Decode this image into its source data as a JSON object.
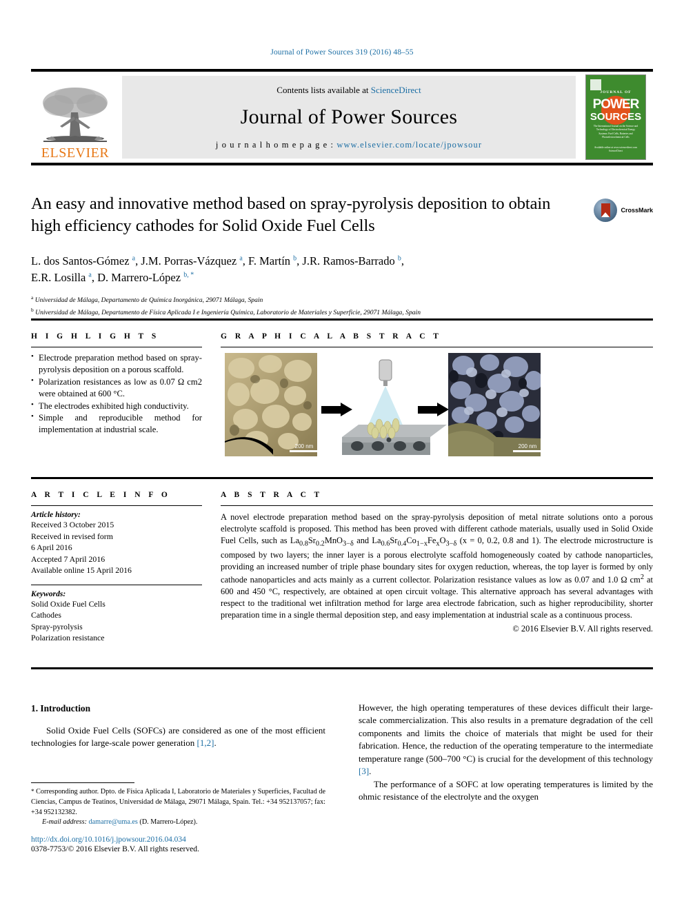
{
  "running_head": "Journal of Power Sources 319 (2016) 48–55",
  "masthead": {
    "publisher": "ELSEVIER",
    "contents_prefix": "Contents lists available at ",
    "contents_link": "ScienceDirect",
    "journal_title": "Journal of Power Sources",
    "homepage_prefix": "j o u r n a l   h o m e p a g e :  ",
    "homepage_url": "www.elsevier.com/locate/jpowsour",
    "cover": {
      "journal_of": "JOURNAL OF",
      "power": "POWER",
      "sources": "SOURCES",
      "blurb": "The International Journal on the Science and Technology of Electrochemical Energy Systems: Fuel Cells, Batteries and Photoelectrochemical Cells",
      "footer": "Available online at www.sciencedirect.com ScienceDirect"
    }
  },
  "article": {
    "title": "An easy and innovative method based on spray-pyrolysis deposition to obtain high efficiency cathodes for Solid Oxide Fuel Cells",
    "crossmark_label": "CrossMark",
    "authors_line1_parts": [
      {
        "name": "L. dos Santos-Gómez ",
        "sup": "a"
      },
      {
        "name": ", J.M. Porras-Vázquez ",
        "sup": "a"
      },
      {
        "name": ", F. Martín ",
        "sup": "b"
      },
      {
        "name": ", J.R. Ramos-Barrado ",
        "sup": "b"
      }
    ],
    "authors_line2_parts": [
      {
        "name": "E.R. Losilla ",
        "sup": "a"
      },
      {
        "name": ", D. Marrero-López ",
        "sup": "b, *"
      }
    ],
    "affiliations": [
      {
        "marker": "a",
        "text": "Universidad de Málaga, Departamento de Química Inorgánica, 29071 Málaga, Spain"
      },
      {
        "marker": "b",
        "text": "Universidad de Málaga, Departamento de Física Aplicada I e Ingeniería Química, Laboratorio de Materiales y Superficie, 29071 Málaga, Spain"
      }
    ]
  },
  "highlights": {
    "heading": "H I G H L I G H T S",
    "items": [
      "Electrode preparation method based on spray-pyrolysis deposition on a porous scaffold.",
      "Polarization resistances as low as 0.07 Ω cm2 were obtained at 600 °C.",
      "The electrodes exhibited high conductivity.",
      "Simple and reproducible method for implementation at industrial scale."
    ]
  },
  "graphical_abstract": {
    "heading": "G R A P H I C A L   A B S T R A C T",
    "scale_bar_left": "200 nm",
    "scale_bar_right": "200 nm"
  },
  "article_info": {
    "heading": "A R T I C L E   I N F O",
    "history_label": "Article history:",
    "history": [
      "Received 3 October 2015",
      "Received in revised form",
      "6 April 2016",
      "Accepted 7 April 2016",
      "Available online 15 April 2016"
    ],
    "keywords_label": "Keywords:",
    "keywords": [
      "Solid Oxide Fuel Cells",
      "Cathodes",
      "Spray-pyrolysis",
      "Polarization resistance"
    ]
  },
  "abstract": {
    "heading": "A B S T R A C T",
    "p1_a": "A novel electrode preparation method based on the spray-pyrolysis deposition of metal nitrate solutions onto a porous electrolyte scaffold is proposed. This method has been proved with different cathode materials, usually used in Solid Oxide Fuel Cells, such as ",
    "formula1": "La0.8Sr0.2MnO3−δ",
    "p1_b": " and ",
    "formula2": "La0.6Sr0.4Co1−xFexO3−δ",
    "p1_c": " (x = 0, 0.2, 0.8 and 1). The electrode microstructure is composed by two layers; the inner layer is a porous electrolyte scaffold homogeneously coated by cathode nanoparticles, providing an increased number of triple phase boundary sites for oxygen reduction, whereas, the top layer is formed by only cathode nanoparticles and acts mainly as a current collector. Polarization resistance values as low as 0.07 and 1.0 Ω cm2 at 600 and 450 °C, respectively, are obtained at open circuit voltage. This alternative approach has several advantages with respect to the traditional wet infiltration method for large area electrode fabrication, such as higher reproducibility, shorter preparation time in a single thermal deposition step, and easy implementation at industrial scale as a continuous process.",
    "copyright": "© 2016 Elsevier B.V. All rights reserved."
  },
  "body": {
    "section_number_title": "1.  Introduction",
    "left_p1_a": "Solid Oxide Fuel Cells (SOFCs) are considered as one of the most efficient technologies for large-scale power generation ",
    "left_p1_ref": "[1,2]",
    "left_p1_b": ".",
    "right_p1": "However, the high operating temperatures of these devices difficult their large-scale commercialization. This also results in a premature degradation of the cell components and limits the choice of materials that might be used for their fabrication. Hence, the reduction of the operating temperature to the intermediate temperature range (500–700 °C) is crucial for the development of this technology ",
    "right_p1_ref": "[3]",
    "right_p1_end": ".",
    "right_p2": "The performance of a SOFC at low operating temperatures is limited by the ohmic resistance of the electrolyte and the oxygen"
  },
  "footnote": {
    "star": "*",
    "text": " Corresponding author. Dpto. de Física Aplicada I, Laboratorio de Materiales y Superficies, Facultad de Ciencias, Campus de Teatinos, Universidad de Málaga, 29071 Málaga, Spain. Tel.: +34 952137057; fax: +34 952132382.",
    "email_label": "E-mail address:",
    "email": "damarre@uma.es",
    "email_owner": " (D. Marrero-López)."
  },
  "footer": {
    "doi": "http://dx.doi.org/10.1016/j.jpowsour.2016.04.034",
    "issn": "0378-7753/© 2016 Elsevier B.V. All rights reserved."
  },
  "colors": {
    "link": "#1c6ea4",
    "elsevier_orange": "#E77817",
    "cover_green": "#3e8b2e"
  }
}
